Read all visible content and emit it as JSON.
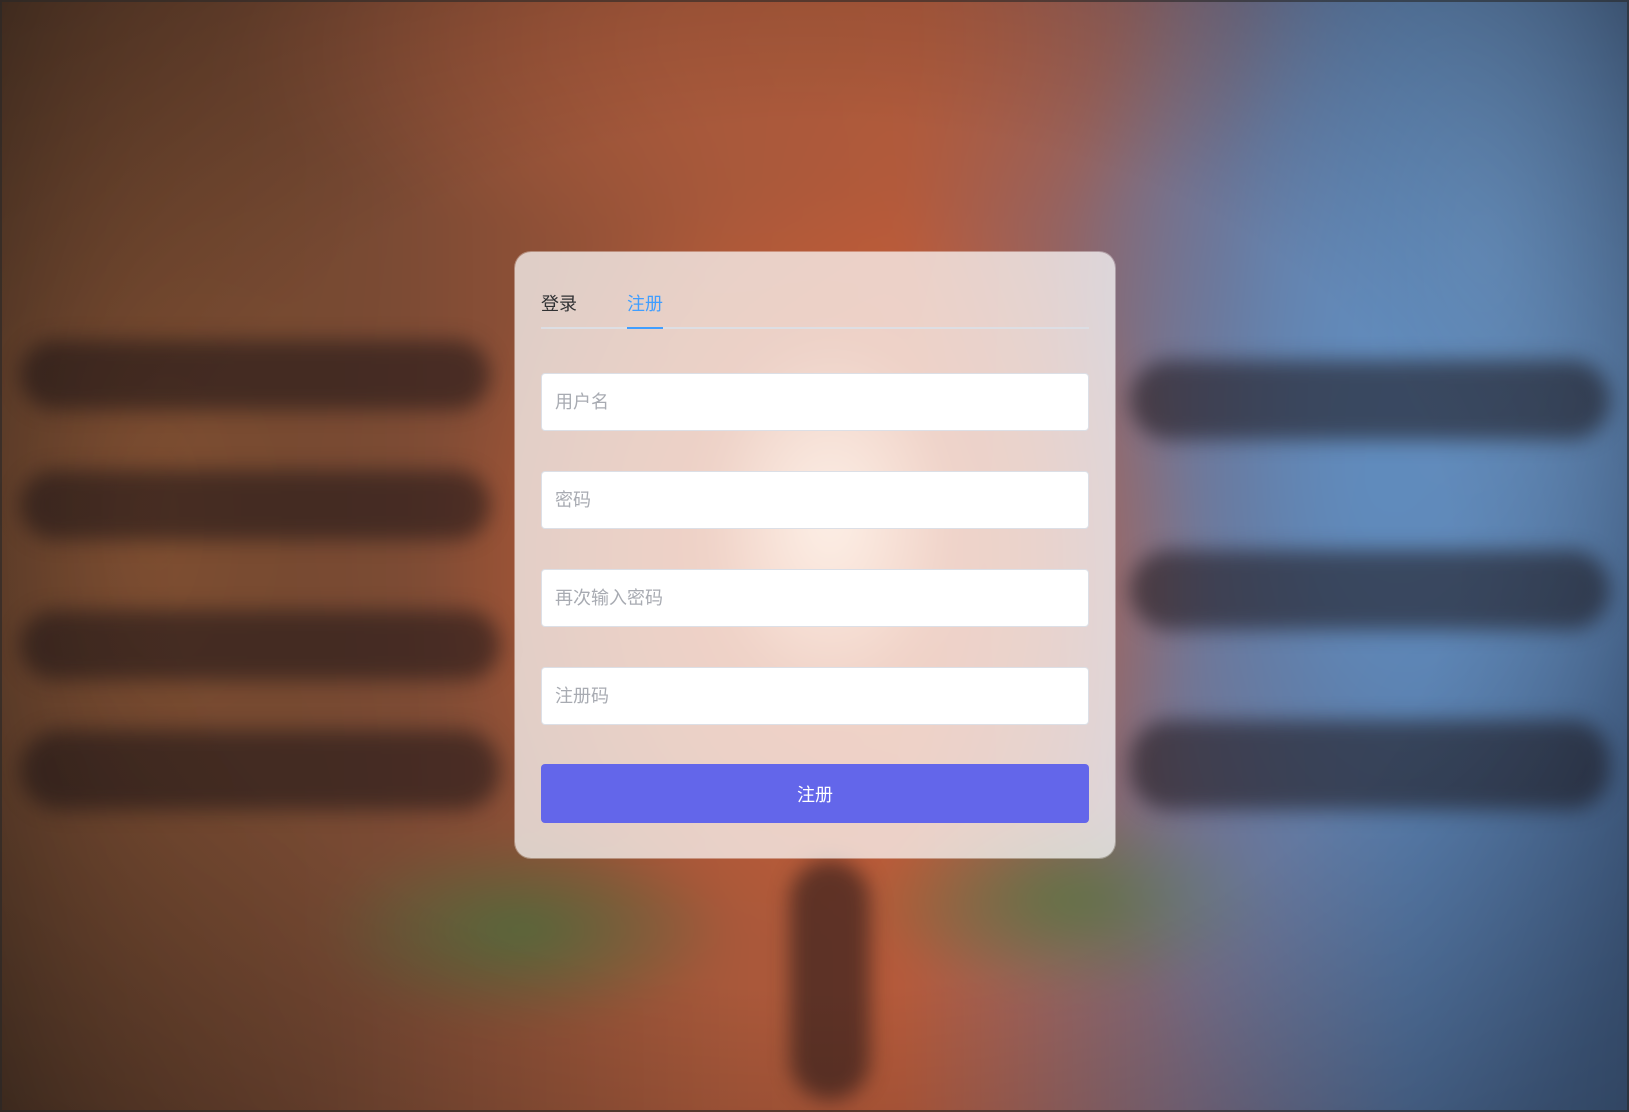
{
  "colors": {
    "accent": "#409eff",
    "button": "#6366ea",
    "text": "#303133",
    "placeholder": "#a8abb2"
  },
  "background": {
    "description_icon": "blurred-scene-background"
  },
  "tabs": [
    {
      "label": "登录",
      "active": false
    },
    {
      "label": "注册",
      "active": true
    }
  ],
  "form": {
    "username": {
      "placeholder": "用户名",
      "value": ""
    },
    "password": {
      "placeholder": "密码",
      "value": ""
    },
    "confirm_password": {
      "placeholder": "再次输入密码",
      "value": ""
    },
    "register_code": {
      "placeholder": "注册码",
      "value": ""
    },
    "submit_label": "注册"
  }
}
